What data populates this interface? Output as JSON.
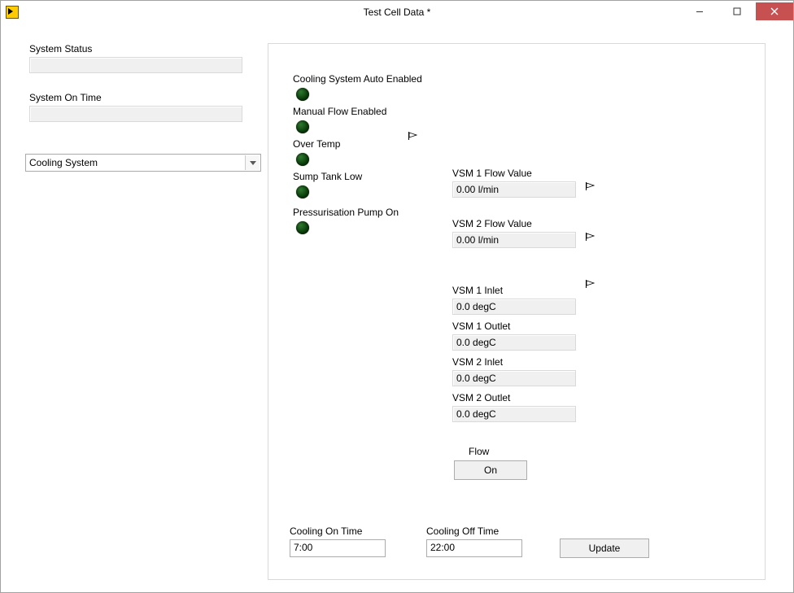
{
  "window": {
    "title": "Test Cell Data *"
  },
  "left": {
    "system_status_label": "System Status",
    "system_status_value": "",
    "system_on_time_label": "System On Time",
    "system_on_time_value": "",
    "page_select_value": "Cooling System"
  },
  "indicators": {
    "0": "Cooling System Auto Enabled",
    "1": "Manual Flow Enabled",
    "2": "Over Temp",
    "3": "Sump Tank Low",
    "4": "Pressurisation Pump On"
  },
  "flows": {
    "vsm1_flow_label": "VSM 1 Flow Value",
    "vsm1_flow_value": "0.00 l/min",
    "vsm2_flow_label": "VSM 2 Flow Value",
    "vsm2_flow_value": "0.00 l/min"
  },
  "temps": {
    "vsm1_inlet_label": "VSM 1 Inlet",
    "vsm1_inlet_value": "0.0 degC",
    "vsm1_outlet_label": "VSM 1 Outlet",
    "vsm1_outlet_value": "0.0 degC",
    "vsm2_inlet_label": "VSM 2 Inlet",
    "vsm2_inlet_value": "0.0 degC",
    "vsm2_outlet_label": "VSM 2 Outlet",
    "vsm2_outlet_value": "0.0 degC"
  },
  "flow": {
    "section_label": "Flow",
    "button_label": "On"
  },
  "sched": {
    "on_label": "Cooling On Time",
    "on_value": "7:00",
    "off_label": "Cooling Off Time",
    "off_value": "22:00",
    "update_label": "Update"
  }
}
